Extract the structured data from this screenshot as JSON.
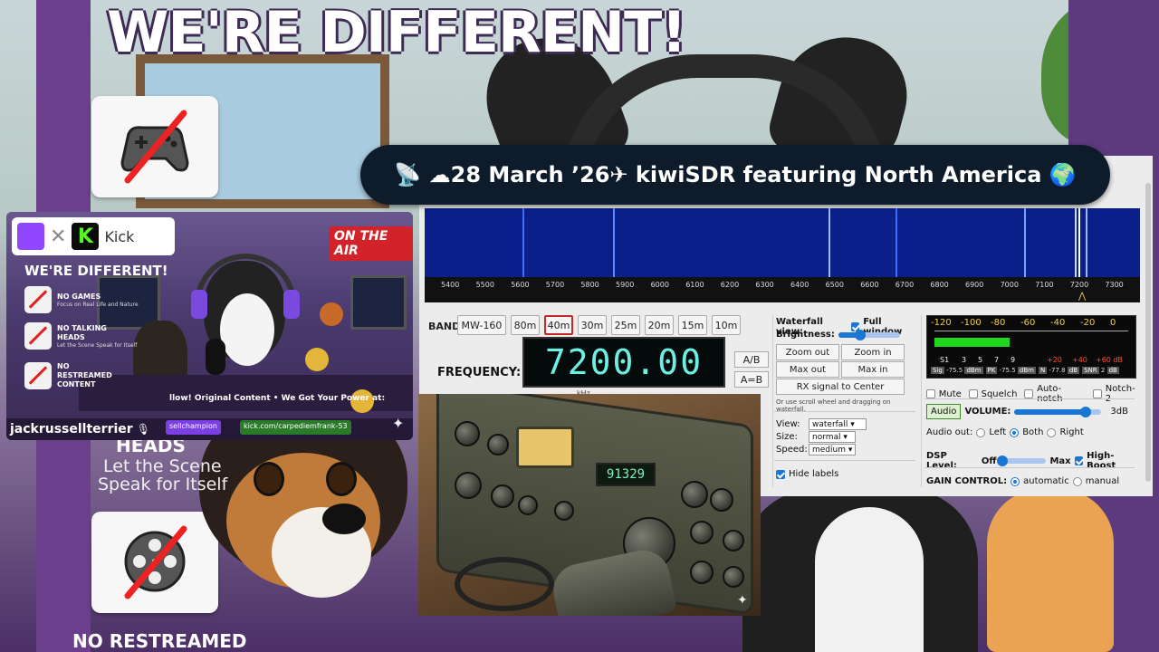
{
  "background": {
    "headline": "WE'RE DIFFERENT!",
    "side_heading": "HEADS",
    "side_sub_1": "Let the Scene",
    "side_sub_2": "Speak for Itself",
    "bottom_text": "NO RESTREAMED",
    "icons": [
      "gamepad-crossed-icon",
      "film-reel-crossed-icon"
    ]
  },
  "title_banner": {
    "text": "📡 ☁28 March ’26✈ kiwiSDR featuring North America 🌍"
  },
  "thumbnail": {
    "twitch_logo": "twitch-logo",
    "x_mark": "✕",
    "kick_logo_letter": "K",
    "kick_label": "Kick",
    "on_air": "ON THE AIR",
    "heading": "WE'RE DIFFERENT!",
    "items": [
      {
        "title": "NO GAMES",
        "sub": "Focus on Real Life and Nature"
      },
      {
        "title": "NO TALKING HEADS",
        "sub": "Let the Scene Speak for Itself"
      },
      {
        "title": "NO RESTREAMED CONTENT",
        "sub": ""
      }
    ],
    "banner_line": "llow! Original Content • We Got Your Power at:",
    "twitch_tag": "sellchampion",
    "kick_tag": "kick.com/carpediemfrank-53",
    "channel_name": "jackrussellterrier",
    "mic_icon": "🎙"
  },
  "sdr": {
    "scale_ticks": [
      "5400",
      "5500",
      "5600",
      "5700",
      "5800",
      "5900",
      "6000",
      "6100",
      "6200",
      "6300",
      "6400",
      "6500",
      "6600",
      "6700",
      "6800",
      "6900",
      "7000",
      "7100",
      "7200",
      "7300"
    ],
    "band_label": "BAND:",
    "bands": [
      "MW-160",
      "80m",
      "40m",
      "30m",
      "25m",
      "20m",
      "15m",
      "10m"
    ],
    "active_band": "40m",
    "frequency_label": "FREQUENCY:",
    "frequency_value": "7200.00",
    "frequency_unit": "kHz",
    "ab_label": "A/B",
    "a_eq_b_label": "A=B",
    "waterfall": {
      "view_label": "Waterfall view:",
      "full_window_label": "Full window",
      "full_window_checked": true,
      "brightness_label": "Brightness:",
      "brightness_level": 0.35,
      "zoom_out": "Zoom out",
      "zoom_in": "Zoom in",
      "max_out": "Max out",
      "max_in": "Max in",
      "rx_center": "RX signal to Center",
      "note": "Or use scroll wheel and dragging on waterfall.",
      "view_sel_label": "View:",
      "view_sel_value": "waterfall",
      "size_sel_label": "Size:",
      "size_sel_value": "normal",
      "speed_sel_label": "Speed:",
      "speed_sel_value": "medium",
      "hide_labels": "Hide labels",
      "hide_labels_checked": true
    },
    "smeter": {
      "db_ticks": [
        "-120",
        "-100",
        "-80",
        "-60",
        "-40",
        "-20",
        "0"
      ],
      "s_ticks": [
        "S1",
        "3",
        "5",
        "7",
        "9",
        "+20",
        "+40",
        "+60 dB"
      ],
      "level_fraction": 0.39,
      "sig_label": "Sig",
      "sig_value": "-75.5",
      "sig_unit": "dBm",
      "pk_label": "PK",
      "pk_value": "-75.5",
      "pk_unit": "dBm",
      "n_label": "N",
      "n_value": "-77.8",
      "n_unit": "dB",
      "snr_label": "SNR",
      "snr_value": "2",
      "snr_unit": "dB"
    },
    "audio": {
      "mute": "Mute",
      "squelch": "Squelch",
      "autonotch": "Auto-notch",
      "notch2": "Notch-2",
      "audio_btn": "Audio",
      "volume_label": "VOLUME:",
      "volume_value": "3dB",
      "volume_level": 0.82,
      "audio_out_label": "Audio out:",
      "out_left": "Left",
      "out_both": "Both",
      "out_right": "Right",
      "dsp_label": "DSP Level:",
      "dsp_off": "Off",
      "dsp_max": "Max",
      "dsp_level": 0.04,
      "highboost": "High-Boost",
      "highboost_checked": true,
      "gain_label": "GAIN CONTROL:",
      "gain_auto": "automatic",
      "gain_manual": "manual"
    }
  },
  "radio_art": {
    "display_digits": "91329"
  }
}
